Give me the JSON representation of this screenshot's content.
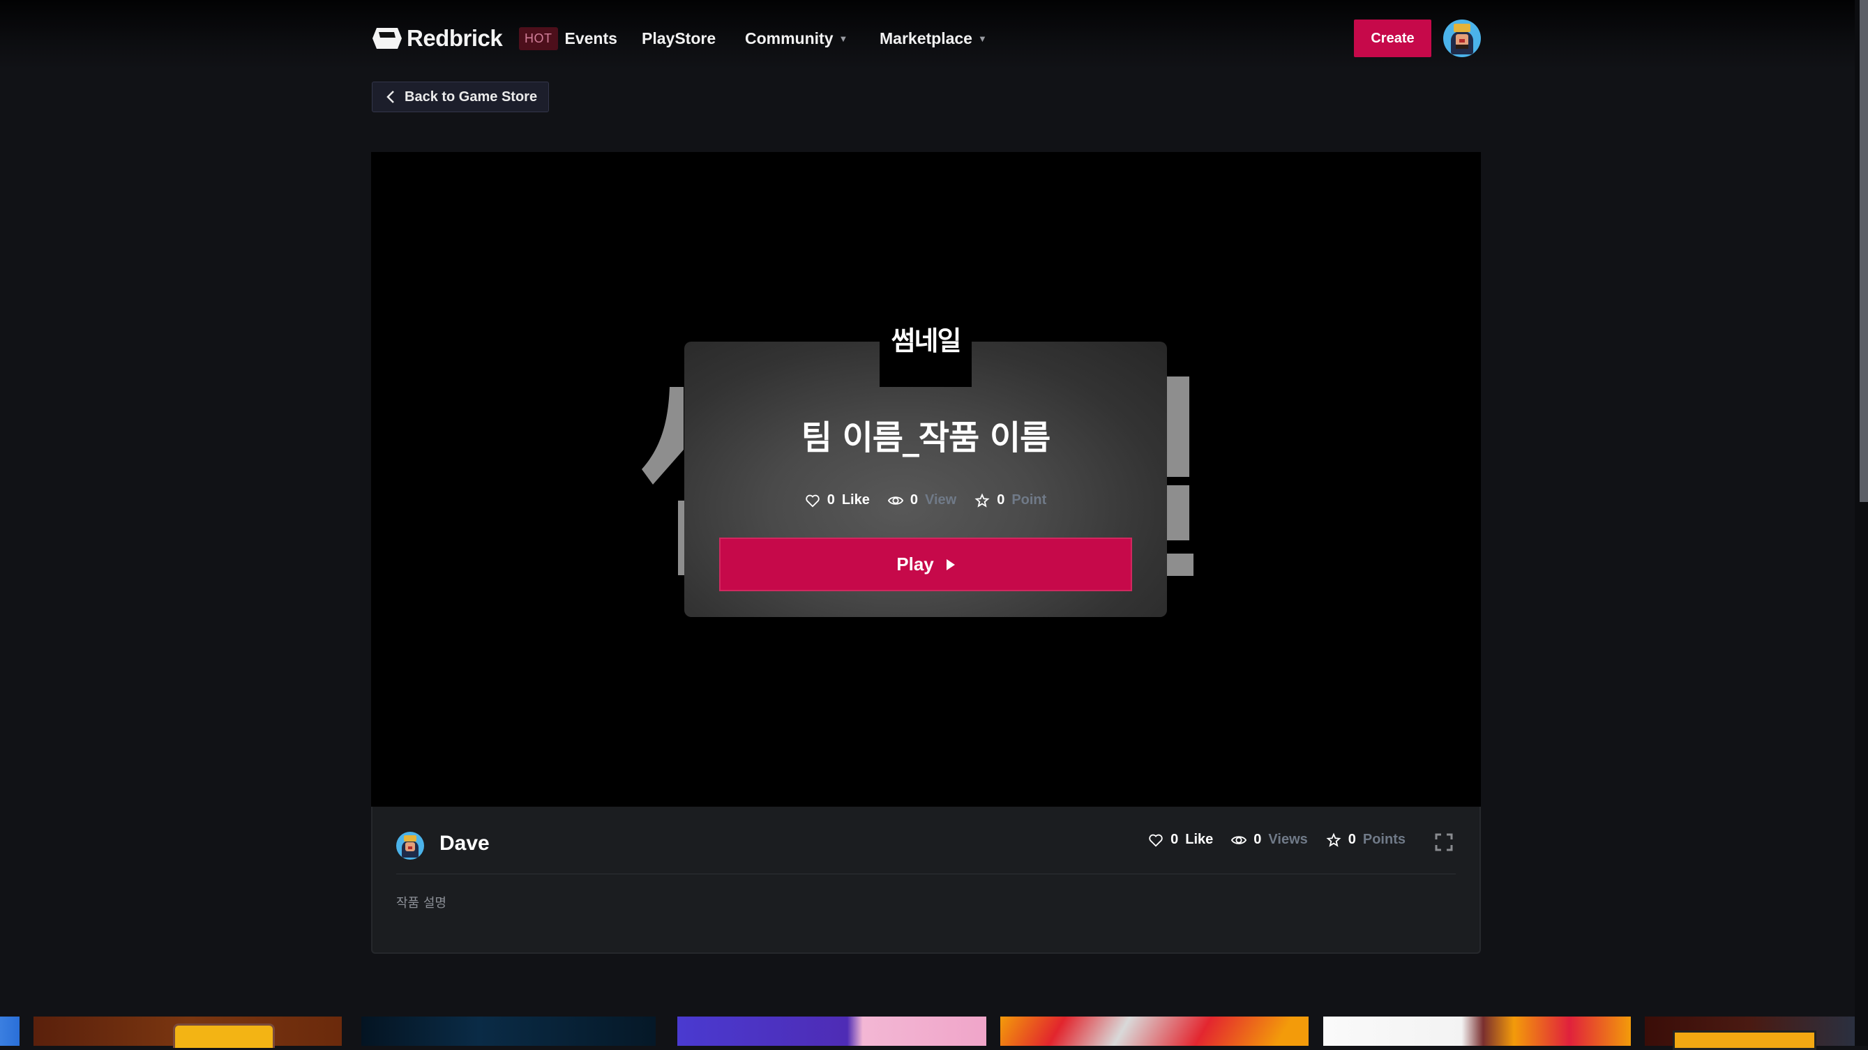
{
  "header": {
    "brand": "Redbrick",
    "nav": [
      {
        "badge": "HOT",
        "label": "Events",
        "has_dropdown": false
      },
      {
        "label": "PlayStore",
        "has_dropdown": false
      },
      {
        "label": "Community",
        "has_dropdown": true
      },
      {
        "label": "Marketplace",
        "has_dropdown": true
      }
    ],
    "caret": "▼",
    "create_label": "Create",
    "avatar_alt": "user-avatar"
  },
  "back_button": {
    "label": "Back to Game Store",
    "icon": "chevron-left-icon"
  },
  "game": {
    "thumbnail_label": "썸네일",
    "title": "팀 이름_작품 이름",
    "stats": {
      "likes_count": "0",
      "likes_label": "Like",
      "views_count": "0",
      "views_label": "View",
      "points_count": "0",
      "points_label": "Point"
    },
    "play_label": "Play"
  },
  "info": {
    "creator": "Dave",
    "stats": {
      "likes_count": "0",
      "likes_label": "Like",
      "views_count": "0",
      "views_label": "Views",
      "points_count": "0",
      "points_label": "Points"
    },
    "description": "작품 설명"
  },
  "colors": {
    "accent": "#c6094a",
    "hot_badge_bg": "#4d0f1b",
    "hot_badge_text": "#d27f9a",
    "page_bg": "#111216",
    "muted_text": "#707a88"
  },
  "related_games": [
    {
      "name": "game-thumb-1"
    },
    {
      "name": "game-thumb-2"
    },
    {
      "name": "game-thumb-3"
    },
    {
      "name": "game-thumb-4"
    },
    {
      "name": "game-thumb-5"
    },
    {
      "name": "game-thumb-6"
    },
    {
      "name": "game-thumb-7"
    }
  ]
}
